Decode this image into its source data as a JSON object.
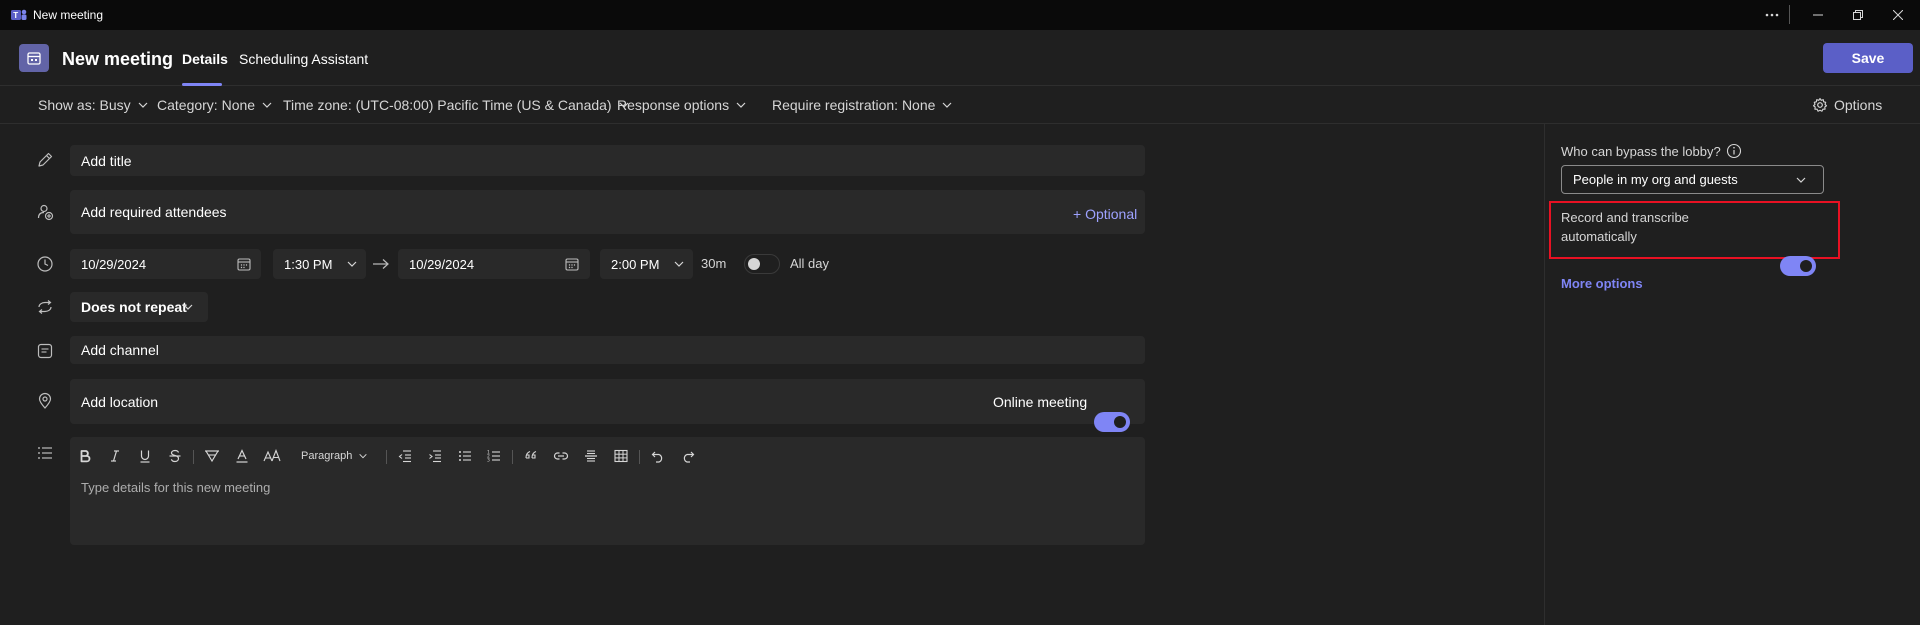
{
  "window": {
    "title": "New meeting"
  },
  "header": {
    "title": "New meeting",
    "tabs": [
      {
        "label": "Details",
        "active": true
      },
      {
        "label": "Scheduling Assistant",
        "active": false
      }
    ],
    "save_label": "Save"
  },
  "options_bar": {
    "show_as": "Show as: Busy",
    "category": "Category: None",
    "time_zone": "Time zone: (UTC-08:00) Pacific Time (US & Canada)",
    "response_options": "Response options",
    "registration": "Require registration: None",
    "options_label": "Options"
  },
  "form": {
    "title_placeholder": "Add title",
    "attendees_placeholder": "Add required attendees",
    "optional_label": "+ Optional",
    "start_date": "10/29/2024",
    "start_time": "1:30 PM",
    "end_date": "10/29/2024",
    "end_time": "2:00 PM",
    "duration": "30m",
    "all_day_label": "All day",
    "all_day_on": false,
    "repeat": "Does not repeat",
    "channel_placeholder": "Add channel",
    "location_placeholder": "Add location",
    "online_meeting_label": "Online meeting",
    "online_meeting_on": true
  },
  "editor": {
    "paragraph_style": "Paragraph",
    "placeholder": "Type details for this new meeting"
  },
  "side_panel": {
    "lobby_label": "Who can bypass the lobby?",
    "lobby_value": "People in my org and guests",
    "record_label_line1": "Record and transcribe",
    "record_label_line2": "automatically",
    "record_on": true,
    "more_options": "More options"
  },
  "colors": {
    "accent": "#5b5fc7",
    "toggle_on": "#7f85f5",
    "link": "#9ea2ff",
    "highlight": "#e81123",
    "background": "#1f1f1f",
    "field": "#292929"
  }
}
